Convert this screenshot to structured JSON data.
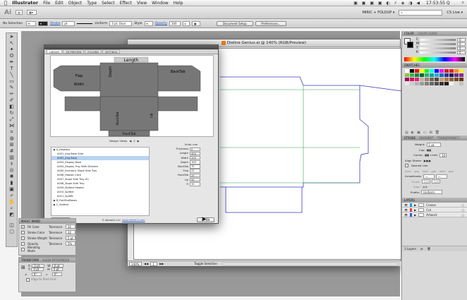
{
  "menubar": {
    "apple": "",
    "items": [
      "Illustrator",
      "File",
      "Edit",
      "Object",
      "Type",
      "Select",
      "Effect",
      "View",
      "Window",
      "Help"
    ],
    "clock": "17:53:55 Q"
  },
  "appbar": {
    "logo": "Ai",
    "workspace": "MIRIC + FOLDUP ▾",
    "cslive": "CS Live ▾"
  },
  "ctrlbar": {
    "selection": "No Selection",
    "stroke_label": "Stroke",
    "stroke_value": "pt",
    "uniform": "Uniform",
    "brush": "3 pt. Oval",
    "style_label": "Style",
    "opacity_label": "Opacity",
    "opacity_value": "100",
    "document_setup": "Document Setup",
    "preferences": "Preferences..."
  },
  "document": {
    "title": "Dieline Genius.ai @ 140% (RGB/Preview)",
    "zoom": "140%",
    "page": "1",
    "status": "Toggle Selection"
  },
  "plugin": {
    "tabs": [
      "LIBRARY",
      "3D PREVIEW",
      "FOLDING",
      "SETTINGS"
    ],
    "dims": {
      "length": "Length",
      "flap": "Flap",
      "width": "Width",
      "depth": "Depth",
      "backtab": "BackTab",
      "backtab2": "BackTab",
      "lip": "Lip",
      "fronttab": "FrontTab"
    },
    "design_views_label": "Design Views",
    "design_views_value": "2",
    "units_label": "Units: mm",
    "tree": [
      {
        "label": "▶ A_Displays",
        "sel": false
      },
      {
        "label": "A001_Ang Base Side",
        "sel": false
      },
      {
        "label": "A002_Ang Base",
        "sel": true
      },
      {
        "label": "A003_Display Base",
        "sel": false
      },
      {
        "label": "A004_Display Tray With Dividers",
        "sel": false
      },
      {
        "label": "A005_Economy Slope Side Tray",
        "sel": false
      },
      {
        "label": "A006_Header Card",
        "sel": false
      },
      {
        "label": "A007_Slope Side Tray #1",
        "sel": false
      },
      {
        "label": "A008_Slope Side Tray",
        "sel": false
      },
      {
        "label": "A009_Slotted Header",
        "sel": false
      },
      {
        "label": "A010_Splitkit",
        "sel": false
      },
      {
        "label": "A011_Splitflt",
        "sel": false
      },
      {
        "label": "▶ B_FoldEndBoxes",
        "sel": false
      },
      {
        "label": "▶ C_Slotted",
        "sel": false
      }
    ],
    "params": [
      {
        "label": "Thickness",
        "value": "0"
      },
      {
        "label": "Length",
        "value": "400"
      },
      {
        "label": "Width",
        "value": "200"
      },
      {
        "label": "Depth",
        "value": "100"
      },
      {
        "label": "BackTab",
        "value": "75"
      },
      {
        "label": "Flap",
        "value": "22"
      },
      {
        "label": "FrontTab",
        "value": "20"
      },
      {
        "label": "Lip",
        "value": "50"
      },
      {
        "label": "R",
        "value": "10"
      }
    ],
    "catalog": "CATALOG",
    "copyright": "© AlphaCo LLC",
    "link": "www.AlphaCo.com",
    "open": "OPEN"
  },
  "magic_wand": {
    "title": "MAGIC WAND",
    "rows": [
      {
        "label": "Fill Color",
        "tol_label": "Tolerance",
        "tol": "32",
        "checked": true
      },
      {
        "label": "Stroke Color",
        "tol_label": "Tolerance",
        "tol": "32",
        "checked": false
      },
      {
        "label": "Stroke Weight",
        "tol_label": "Tolerance",
        "tol": "5 pt",
        "checked": false
      },
      {
        "label": "Opacity",
        "tol_label": "Tolerance",
        "tol": "5%",
        "checked": false
      },
      {
        "label": "Blending Mode",
        "tol_label": "",
        "tol": "",
        "checked": false
      }
    ]
  },
  "transform": {
    "title": "TRANSFORM",
    "tab2": "ALIGN PATHFINDER",
    "x_label": "X:",
    "x": "0 pt",
    "y_label": "Y:",
    "y": "0 pt",
    "w_label": "W:",
    "w": "0 pt",
    "h_label": "H:",
    "h": "0 pt",
    "rot": "0°",
    "shear": "0°",
    "align": "Align to Pixel Grid"
  },
  "right": {
    "color_tab": "COLOR",
    "guide_tab": "COLOR GUIDE",
    "channels": [
      {
        "label": "C",
        "value": "0"
      },
      {
        "label": "M",
        "value": "0"
      },
      {
        "label": "Y",
        "value": "0"
      },
      {
        "label": "K",
        "value": "0"
      }
    ],
    "swatches_tab": "SWATCHES",
    "swatch_colors": [
      "#ffffff",
      "#000000",
      "#ff0000",
      "#ffff00",
      "#00ff00",
      "#00ffff",
      "#0000ff",
      "#ff00ff",
      "#c1272d",
      "#ed1c24",
      "#f7931e",
      "#fcee21",
      "#8cc63f",
      "#39b54a",
      "#009245",
      "#006837",
      "#22b573",
      "#00a99d",
      "#29abe2",
      "#0071bc",
      "#2e3192",
      "#1b1464",
      "#662d91",
      "#93278f",
      "#9e005d",
      "#d4145a",
      "#ed1e79",
      "#c7b299",
      "#998675",
      "#736357",
      "#534741",
      "#c69c6d",
      "#a67c52",
      "#8c6239",
      "#754c24",
      "#603813",
      "#e6e6e6",
      "#cccccc",
      "#b3b3b3",
      "#999999",
      "#808080",
      "#666666",
      "#4d4d4d",
      "#333333",
      "#1a1a1a",
      "#f2f2f2",
      "#d9d9d9",
      "#bfbfbf"
    ],
    "stroke_tab": "STROKE",
    "gradient_tab": "GRADIENT",
    "transparency_tab": "TRANSPARENCY",
    "weight_label": "Weight:",
    "weight": "1 pt",
    "cap_label": "Cap:",
    "corner_label": "Corner:",
    "limit_label": "Limit:",
    "limit": "10",
    "align_label": "Align Stroke:",
    "dashed": "Dashed Line",
    "dash_labels": [
      "dash",
      "gap",
      "dash",
      "gap",
      "dash",
      "gap"
    ],
    "arrowheads": "Arrowheads:",
    "scale": "Scale:",
    "scale1": "100",
    "scale2": "100",
    "align2": "Align:",
    "profile": "Profile:",
    "profile_value": "Uniform",
    "layers_tab": "LAYERS",
    "layers": [
      {
        "name": "Crease",
        "color": "#00a0ff"
      },
      {
        "name": "Cut",
        "color": "#ff3b30"
      },
      {
        "name": "Artwork",
        "color": "#2b5ce6"
      }
    ],
    "layers_footer": "3 Layers"
  }
}
